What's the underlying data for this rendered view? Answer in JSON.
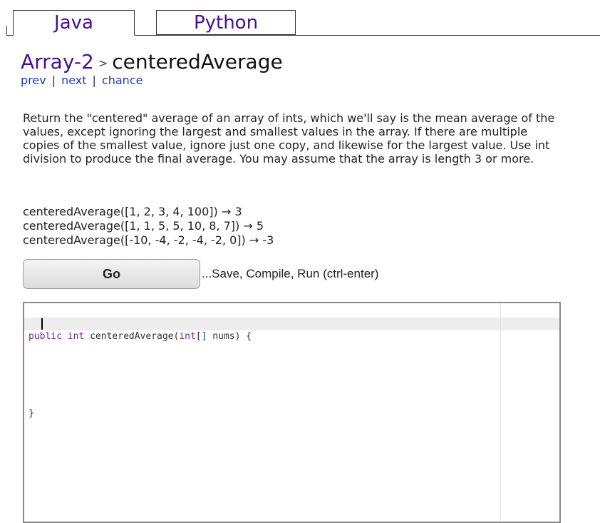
{
  "tabs": [
    {
      "label": "Java",
      "active": true
    },
    {
      "label": "Python",
      "active": false
    }
  ],
  "title": {
    "section": "Array-2",
    "separator": ">",
    "problem": "centeredAverage"
  },
  "nav": {
    "prev": "prev",
    "next": "next",
    "chance": "chance",
    "divider": "|"
  },
  "description": "Return the \"centered\" average of an array of ints, which we'll say is the mean average of the values, except ignoring the largest and smallest values in the array. If there are multiple copies of the smallest value, ignore just one copy, and likewise for the largest value. Use int division to produce the final average. You may assume that the array is length 3 or more.",
  "examples": [
    "centeredAverage([1, 2, 3, 4, 100]) → 3",
    "centeredAverage([1, 1, 5, 5, 10, 8, 7]) → 5",
    "centeredAverage([-10, -4, -2, -4, -2, 0]) → -3"
  ],
  "go_button": {
    "label": "Go",
    "hint": "...Save, Compile, Run (ctrl-enter)"
  },
  "editor": {
    "line1_kw1": "public",
    "line1_kw2": "int",
    "line1_name": " centeredAverage(",
    "line1_kw3": "int",
    "line1_rest": "[] nums) {",
    "line3": "}"
  },
  "colors": {
    "tab_text": "#4a0f8f",
    "link": "#1a3bb5",
    "keyword": "#7a1fa2"
  }
}
